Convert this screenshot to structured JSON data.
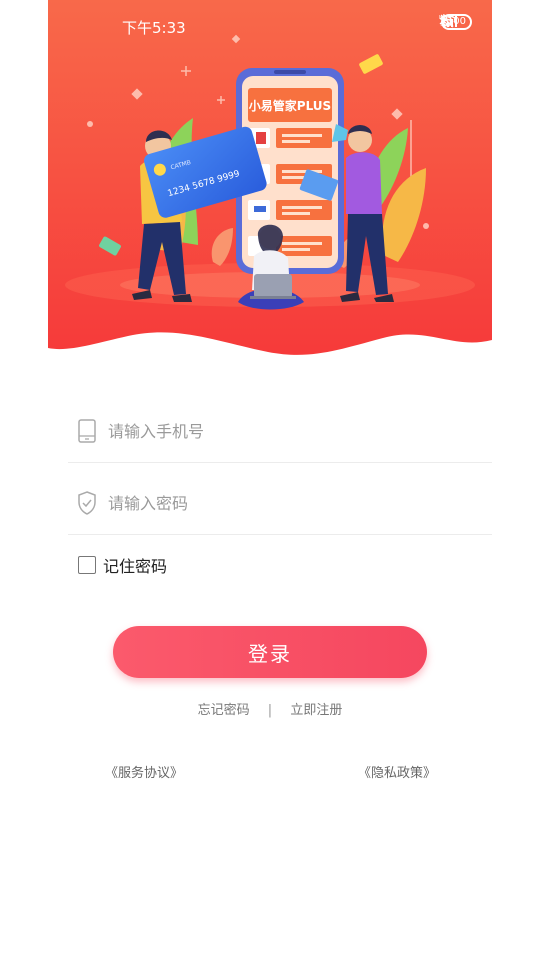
{
  "status_bar": {
    "time": "下午5:33",
    "battery": "100",
    "network": "HD"
  },
  "header": {
    "phone_screen_title": "小易管家PLUS",
    "card_number": "1234 5678 9999",
    "card_brand": "CATMB",
    "colors": {
      "gradient_top": "#f8694a",
      "gradient_bottom": "#f63a3a"
    }
  },
  "form": {
    "phone_placeholder": "请输入手机号",
    "password_placeholder": "请输入密码",
    "remember_label": "记住密码"
  },
  "login_button": "登录",
  "links": {
    "forgot": "忘记密码",
    "separator": "|",
    "register": "立即注册"
  },
  "agreements": {
    "service": "《服务协议》",
    "privacy": "《隐私政策》"
  },
  "accent_color": "#f5475f"
}
